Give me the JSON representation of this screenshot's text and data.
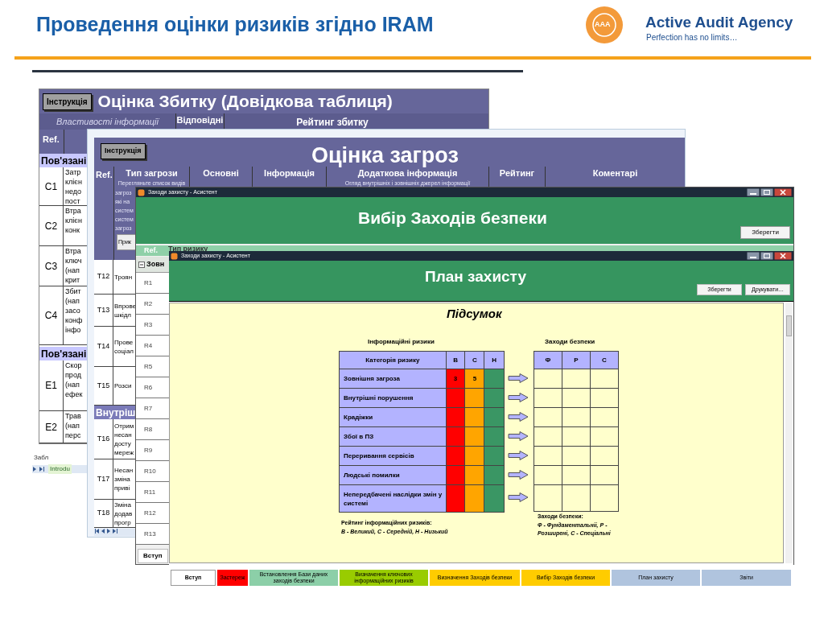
{
  "slide": {
    "title": "Проведення оцінки ризиків згідно IRAM",
    "logo": {
      "mark": "AAA",
      "name": "Active Audit Agency",
      "tagline": "Perfection has no limits…"
    }
  },
  "damage_sheet": {
    "button": "Інструкція",
    "title": "Оцінка Збитку (Довідкова таблиця)",
    "header_cells": [
      "Властивості інформації",
      "Відповідні",
      "Рейтинг збитку"
    ],
    "ref_header": "Ref.",
    "groups": [
      {
        "label": "Пов'язані",
        "rows": [
          {
            "ref": "C1",
            "text": "Затр клієн недо пост"
          },
          {
            "ref": "C2",
            "text": "Втра клієн конк"
          },
          {
            "ref": "C3",
            "text": "Втра ключ (нап крит"
          },
          {
            "ref": "C4",
            "text": "Збит (нап засо конф інфо"
          }
        ]
      },
      {
        "label": "Пов'язані",
        "rows": [
          {
            "ref": "E1",
            "text": "Скор прод (нап ефек"
          },
          {
            "ref": "E2",
            "text": "Трав (нап перс"
          }
        ]
      }
    ],
    "footer": "Забл",
    "sheet_tab": "Introdu"
  },
  "threat_sheet": {
    "button": "Інструкція",
    "title": "Оцінка загроз",
    "ref_header": "Ref.",
    "columns": [
      {
        "label": "Тип загрози",
        "hint": "Перегляньте список видів"
      },
      {
        "label": "Основні"
      },
      {
        "label": "Інформація"
      },
      {
        "label": "Додаткова інформація",
        "hint": "Огляд внутрішніх і зовнішніх джерел інформації"
      },
      {
        "label": "Рейтинг"
      },
      {
        "label": "Коментарі"
      }
    ],
    "hint_fragment": "загроз які на систем систем загроз",
    "example_button": "Прик",
    "groups": [
      {
        "rows": [
          {
            "ref": "T12",
            "text": "Троян"
          },
          {
            "ref": "T13",
            "text": "Впрове шкідл"
          },
          {
            "ref": "T14",
            "text": "Прове соціал"
          },
          {
            "ref": "T15",
            "text": "Розси"
          }
        ]
      },
      {
        "label": "Внутріш",
        "rows": [
          {
            "ref": "T16",
            "text": "Отрим несан досту мереж"
          },
          {
            "ref": "T17",
            "text": "Несан зміна приві"
          },
          {
            "ref": "T18",
            "text": "Зміна додав прогр"
          }
        ]
      }
    ]
  },
  "selection_window": {
    "title": "Заходи захисту - Асистент",
    "heading": "Вибір Заходів безпеки",
    "save_button": "Зберегти",
    "columns": [
      "Ref.",
      "Тип ризику"
    ],
    "group": "Зовн",
    "expanded": true,
    "rows": [
      "R1",
      "R2",
      "R3",
      "R4",
      "R5",
      "R6",
      "R7",
      "R8",
      "R9",
      "R10",
      "R11",
      "R12",
      "R13"
    ],
    "bottom_tab": "Вступ"
  },
  "plan_window": {
    "title": "Заходи захисту - Асистент",
    "heading": "План захисту",
    "buttons": [
      "Зберегти",
      "Друкувати…"
    ],
    "summary": "Підсумок",
    "risks_title": "Інформаційні ризики",
    "measures_title": "Заходи безпеки",
    "risk_header": "Категорія ризику",
    "ratings": [
      {
        "label": "В",
        "color": "#ff0000"
      },
      {
        "label": "С",
        "color": "#ffa500"
      },
      {
        "label": "Н",
        "color": "#3a9664"
      }
    ],
    "risks": [
      {
        "category": "Зовнішня загроза",
        "counts": [
          "3",
          "5"
        ]
      },
      {
        "category": "Внутрішні порушення"
      },
      {
        "category": "Крадіжки"
      },
      {
        "category": "Збої в ПЗ"
      },
      {
        "category": "Переривання сервісів"
      },
      {
        "category": "Людські помилки"
      },
      {
        "category": "Непередбачені наслідки змін у системі"
      }
    ],
    "measure_columns": [
      "Ф",
      "Р",
      "С"
    ],
    "risk_legend": {
      "title": "Рейтинг інформаційних ризиків:",
      "text": "В - Великий, С - Середній, Н - Низький"
    },
    "measure_legend": {
      "title": "Заходи безпеки:",
      "text": "Ф - Фундаментальніі, Р - Розширені, С - Спеціальні"
    },
    "tabs": [
      {
        "label": "Вступ",
        "color": "#ffffff",
        "selected": true
      },
      {
        "label": "Застереж",
        "color": "#ff0000",
        "selected": false
      },
      {
        "label": "Встановлення Бази даних заходів безпеки",
        "color": "#8ccfa8",
        "selected": false
      },
      {
        "label": "Визначення ключових інформаційних ризиків",
        "color": "#99cc00",
        "selected": false
      },
      {
        "label": "Визначення Заходів безпеки",
        "color": "#ffcc00",
        "selected": false
      },
      {
        "label": "Вибір Заходів безпеки",
        "color": "#ffcc00",
        "selected": false
      },
      {
        "label": "План захисту",
        "color": "#b0c4de",
        "selected": false
      },
      {
        "label": "Звіти",
        "color": "#b0c4de",
        "selected": false
      }
    ]
  }
}
